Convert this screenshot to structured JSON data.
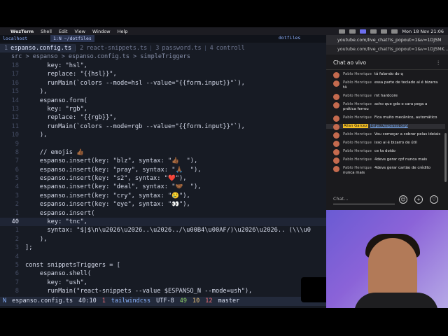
{
  "menubar": {
    "app": "WezTerm",
    "items": [
      "Shell",
      "Edit",
      "View",
      "Window",
      "Help"
    ],
    "clock": "Mon 18 Nov 21:06"
  },
  "terminal": {
    "location": "localhost",
    "cwd_tab": "1:N ~/dotfiles",
    "right_label": "dotfiles",
    "tabs": [
      {
        "num": "1",
        "label": "espanso.config.ts"
      },
      {
        "num": "2",
        "label": "react-snippets.ts"
      },
      {
        "num": "3",
        "label": "password.ts"
      },
      {
        "num": "4",
        "label": "controll"
      }
    ],
    "breadcrumb": "src > espanso > espanso.config.ts > simpleTriggers",
    "lines": [
      {
        "n": "",
        "t": "      key: \"hsl\","
      },
      {
        "n": "",
        "t": "      replace: \"{{hsl}}\","
      },
      {
        "n": "",
        "t": "      runMain(`colors --mode=hsl --value=\"{{form.input}}\"`),"
      },
      {
        "n": "",
        "t": "    ),"
      },
      {
        "n": "",
        "t": "    espanso.form("
      },
      {
        "n": "",
        "t": "      key: \"rgb\","
      },
      {
        "n": "",
        "t": "      replace: \"{{rgb}}\","
      },
      {
        "n": "",
        "t": "      runMain(`colors --mode=rgb --value=\"{{form.input}}\"`),"
      },
      {
        "n": "",
        "t": "    ),"
      },
      {
        "n": "",
        "t": ""
      },
      {
        "n": "",
        "t": "    // emojis 👍🏾"
      },
      {
        "n": "",
        "t": "    espanso.insert(key: \"blz\", syntax: \"👍🏾  \"),"
      },
      {
        "n": "",
        "t": "    espanso.insert(key: \"pray\", syntax: \"🙏🏾  \"),"
      },
      {
        "n": "",
        "t": "    espanso.insert(key: \"s2\", syntax: \"❤️\"),"
      },
      {
        "n": "",
        "t": "    espanso.insert(key: \"deal\", syntax: \"🤝🏾  \"),"
      },
      {
        "n": "",
        "t": "    espanso.insert(key: \"cry\", syntax: \"😢\"),"
      },
      {
        "n": "",
        "t": "    espanso.insert(key: \"eye\", syntax: \"👀\"),"
      },
      {
        "n": "",
        "t": "    espanso.insert("
      },
      {
        "n": "40",
        "t": "      key: \"tnc\","
      },
      {
        "n": "",
        "t": "      syntax: \"$|$\\n\\u2026\\u2026..\\u2026../\\u00B4\\u00AF/)\\u2026\\u2026.. (\\\\\\u0"
      },
      {
        "n": "",
        "t": "    ),"
      },
      {
        "n": "",
        "t": "];"
      },
      {
        "n": "",
        "t": ""
      },
      {
        "n": "",
        "t": "const snippetsTriggers = ["
      },
      {
        "n": "",
        "t": "    espanso.shell("
      },
      {
        "n": "",
        "t": "      key: \"ush\","
      },
      {
        "n": "",
        "t": "      runMain(\"react-snippets --value $ESPANSO_N --mode=ush\"),"
      }
    ],
    "status": {
      "mode": "N",
      "file": "espanso.config.ts",
      "position": "40:10",
      "errors": "1",
      "lsp": "tailwindcss",
      "encoding": "UTF-8",
      "added": "49",
      "changed": "10",
      "removed": "12",
      "branch": "master"
    }
  },
  "browser": {
    "tab_title": "youtube.com/live_chat?is_popout=1&v=1DJ5MK...",
    "url": "youtube.com/live_chat?is_popout=1&v=1DJ5MK...",
    "chat_title": "Chat ao vivo",
    "chat_placeholder": "Chat...",
    "messages": [
      {
        "author": "Pablo Henrique",
        "text": "tá falando do q"
      },
      {
        "author": "Pablo Henrique",
        "text": "essa parte de teclado ai é bizarra tá"
      },
      {
        "author": "Pablo Henrique",
        "text": "mt hardcore"
      },
      {
        "author": "Pablo Henrique",
        "text": "acho que gdo o cara pega a prática ferrou"
      },
      {
        "author": "Pablo Henrique",
        "text": "Fica muito mecânico, automático"
      },
      {
        "author": "Allan Garcez",
        "text": "https://espanso.org/",
        "highlight": true
      },
      {
        "author": "Pablo Henrique",
        "text": "Vou começar a cobrar pelas ideiais"
      },
      {
        "author": "Pablo Henrique",
        "text": "isso ai é bizarro de útil"
      },
      {
        "author": "Pablo Henrique",
        "text": "ce ta doido"
      },
      {
        "author": "Pablo Henrique",
        "text": "4devs gerar cpf nunca mais"
      },
      {
        "author": "Pablo Henrique",
        "text": "4devs gerar cartão de crédito nunca mais"
      }
    ]
  },
  "colors": {
    "terminal_bg": "#171b24",
    "accent": "#8ab4ff",
    "highlight": "#f5c026"
  }
}
